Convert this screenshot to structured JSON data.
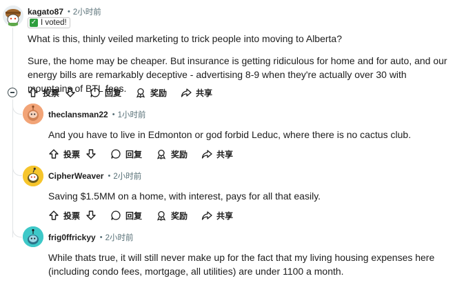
{
  "comments": [
    {
      "author": "kagato87",
      "time": "2小时前",
      "flair": "I voted!",
      "paragraphs": [
        "What is this, thinly veiled marketing to trick people into moving to Alberta?",
        "Sure, the home may be cheaper. But insurance is getting ridiculous for home and for auto, and our energy bills are remarkably deceptive - advertising 8-9 when they're actually over 30 with mountains of BTL fees."
      ]
    },
    {
      "author": "theclansman22",
      "time": "1小时前",
      "paragraphs": [
        "And you have to live in Edmonton or god forbid Leduc, where there is no cactus club."
      ]
    },
    {
      "author": "CipherWeaver",
      "time": "2小时前",
      "paragraphs": [
        "Saving $1.5MM on a home, with interest, pays for all that easily."
      ]
    },
    {
      "author": "frig0ffrickyy",
      "time": "2小时前",
      "paragraphs": [
        "While thats true, it will still never make up for the fact that my living housing expenses here (including condo fees, mortgage, all utilities) are under 1100 a month."
      ]
    }
  ],
  "actions": {
    "vote": "投票",
    "reply": "回复",
    "award": "奖励",
    "share": "共享"
  },
  "colors": {
    "avatar_1_bg": "#e8edf0",
    "avatar_2_bg": "#f2a477",
    "avatar_3_bg": "#f6c52c",
    "avatar_4_bg": "#3ec8c8"
  }
}
